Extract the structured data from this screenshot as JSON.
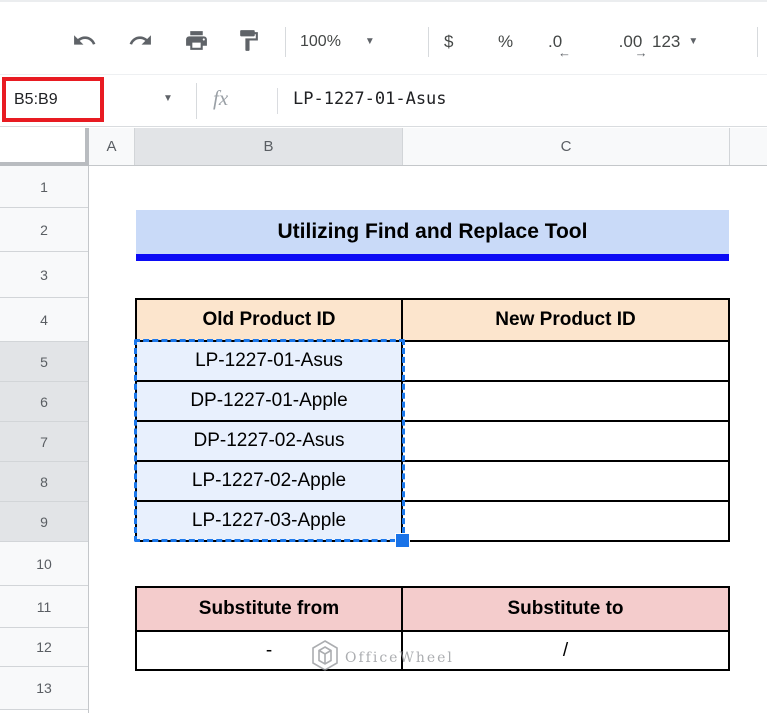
{
  "toolbar": {
    "zoom_value": "100%",
    "currency_label": "$",
    "percent_label": "%",
    "decrease_decimal_label": ".0",
    "decrease_decimal_arrow": "←",
    "increase_decimal_label": ".00",
    "increase_decimal_arrow": "→",
    "more_formats_label": "123"
  },
  "formula_bar": {
    "name_box_value": "B5:B9",
    "fx_label": "fx",
    "formula_value": "LP-1227-01-Asus"
  },
  "grid": {
    "column_headers": [
      "A",
      "B",
      "C"
    ],
    "row_headers": [
      "1",
      "2",
      "3",
      "4",
      "5",
      "6",
      "7",
      "8",
      "9",
      "10",
      "11",
      "12",
      "13"
    ]
  },
  "content": {
    "title": "Utilizing Find and Replace Tool",
    "table1": {
      "headers": [
        "Old Product ID",
        "New Product ID"
      ],
      "rows": [
        "LP-1227-01-Asus",
        "DP-1227-01-Apple",
        "DP-1227-02-Asus",
        "LP-1227-02-Apple",
        "LP-1227-03-Apple"
      ]
    },
    "table2": {
      "headers": [
        "Substitute from",
        "Substitute to"
      ],
      "from_value": "-",
      "to_value": "/"
    }
  },
  "watermark": {
    "text": "OfficeWheel"
  },
  "colors": {
    "title_bg": "#c9daf8",
    "title_underline": "#0b0bf5",
    "table1_header_bg": "#fce5cd",
    "table2_header_bg": "#f4cccc",
    "selection_blue": "#1a73e8",
    "selection_fill": "#e8f0fd",
    "annotation_red": "#e81b22",
    "header_highlight": "#e2e4e7"
  }
}
